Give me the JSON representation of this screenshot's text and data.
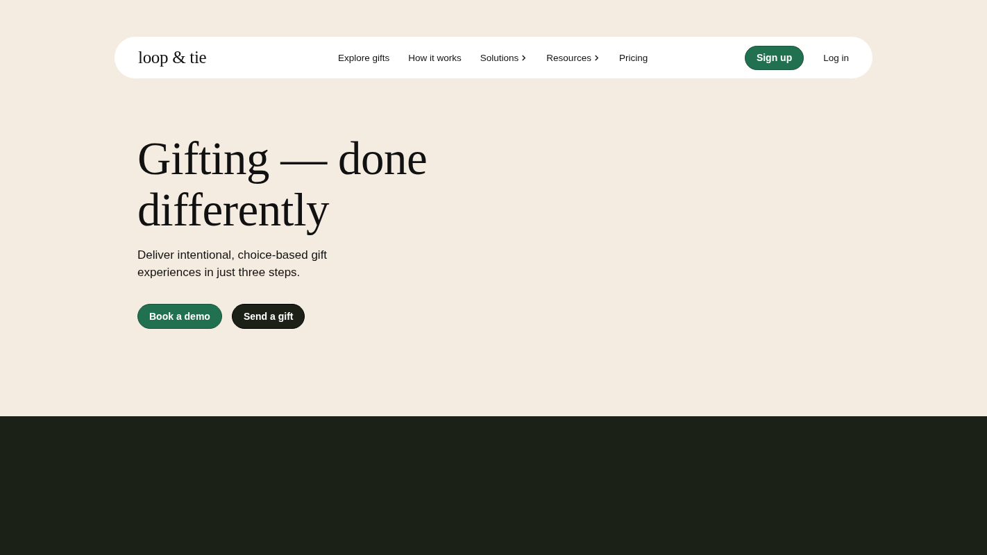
{
  "header": {
    "logo": "loop & tie",
    "nav": [
      {
        "label": "Explore gifts",
        "has_submenu": false
      },
      {
        "label": "How it works",
        "has_submenu": false
      },
      {
        "label": "Solutions",
        "has_submenu": true
      },
      {
        "label": "Resources",
        "has_submenu": true
      },
      {
        "label": "Pricing",
        "has_submenu": false
      }
    ],
    "actions": [
      {
        "label": "Sign up",
        "kind": "primary"
      },
      {
        "label": "Log in",
        "kind": "plain"
      }
    ]
  },
  "hero": {
    "heading": "Gifting — done differently",
    "subtitle": "Deliver intentional, choice-based gift experiences in just three steps.",
    "buttons": [
      {
        "label": "Book a demo",
        "kind": "primary"
      },
      {
        "label": "Send a gift",
        "kind": "dark"
      }
    ]
  }
}
